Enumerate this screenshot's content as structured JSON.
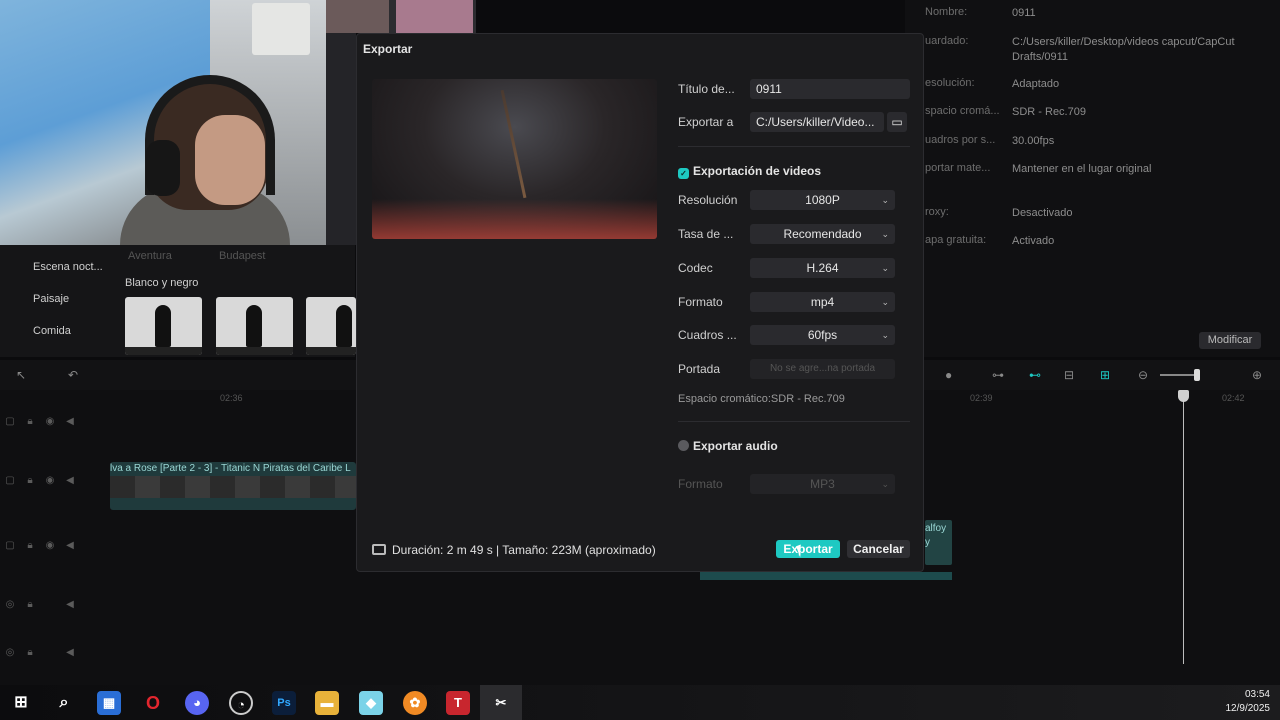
{
  "dialog": {
    "title": "Exportar",
    "title_label": "Título de...",
    "title_value": "0911",
    "export_to_label": "Exportar a",
    "export_to_value": "C:/Users/killer/Video...",
    "video_export_label": "Exportación de videos",
    "video_export_checked": true,
    "rows": [
      {
        "label": "Resolución",
        "value": "1080P"
      },
      {
        "label": "Tasa de ...",
        "value": "Recomendado"
      },
      {
        "label": "Codec",
        "value": "H.264"
      },
      {
        "label": "Formato",
        "value": "mp4"
      },
      {
        "label": "Cuadros ...",
        "value": "60fps"
      }
    ],
    "cover_label": "Portada",
    "cover_value": "No se agre...na portada",
    "color_space": "Espacio cromático:SDR - Rec.709",
    "audio_export_label": "Exportar audio",
    "audio_export_checked": false,
    "audio_format_label": "Formato",
    "audio_format_value": "MP3",
    "footer_info": "Duración: 2 m 49 s | Tamaño: 223M (aproximado)",
    "export_button": "Exportar",
    "cancel_button": "Cancelar"
  },
  "background": {
    "categories": [
      "Escena noct...",
      "Paisaje",
      "Comida"
    ],
    "faded_tabs": [
      "Aventura",
      "Budapest"
    ],
    "section_title": "Blanco y negro",
    "properties": [
      {
        "label": "Nombre:",
        "value": "0911"
      },
      {
        "label": "uardado:",
        "value": "C:/Users/killer/Desktop/videos capcut/CapCut Drafts/0911"
      },
      {
        "label": "esolución:",
        "value": "Adaptado"
      },
      {
        "label": "spacio cromá...",
        "value": "SDR - Rec.709"
      },
      {
        "label": "uadros por s...",
        "value": "30.00fps"
      },
      {
        "label": "portar mate...",
        "value": "Mantener en el lugar original"
      },
      {
        "label": "roxy:",
        "value": "Desactivado"
      },
      {
        "label": "apa gratuita:",
        "value": "Activado"
      }
    ],
    "modify_button": "Modificar",
    "ruler": [
      "02:36",
      "02:39",
      "02:42"
    ],
    "clip_label": "lva a Rose [Parte 2 - 3] - Titanic N  Piratas del Caribe  L",
    "clip2_label": "alfoy y"
  },
  "taskbar": {
    "time": "03:54",
    "date": "12/9/2025"
  },
  "colors": {
    "accent": "#1ec9c2",
    "dialog_bg": "#1a1a1c",
    "field_bg": "#2a2a2e"
  }
}
